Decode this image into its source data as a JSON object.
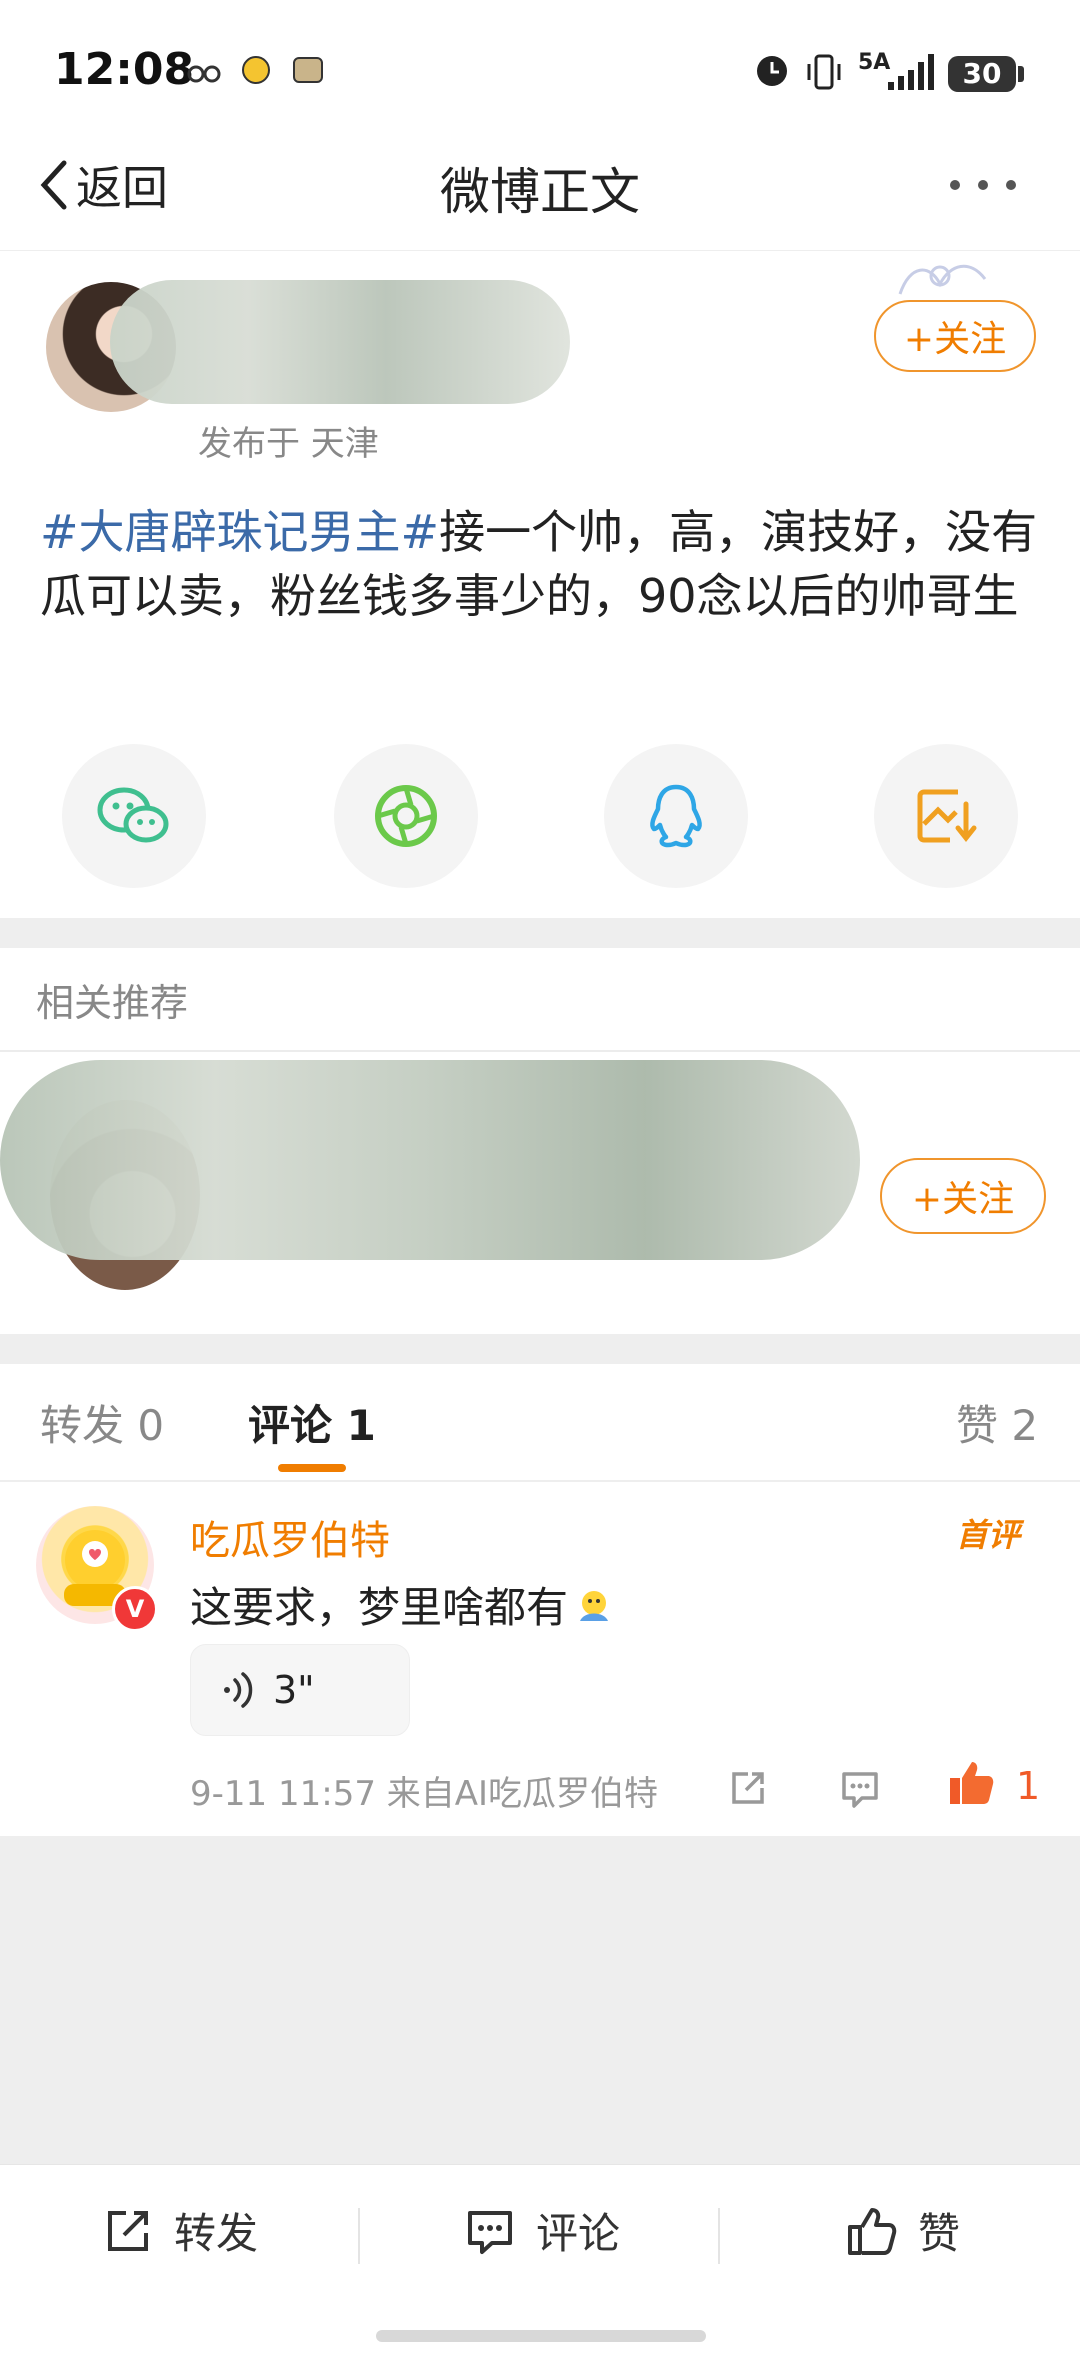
{
  "status_bar": {
    "time": "12:08",
    "network": "5A",
    "battery": "30"
  },
  "nav": {
    "back_label": "返回",
    "title": "微博正文"
  },
  "post": {
    "location": "发布于 天津",
    "follow_label": "+关注",
    "topic": "#大唐辟珠记男主#",
    "text": "接一个帅，高，演技好，没有瓜可以卖，粉丝钱多事少的，90念以后的帅哥生"
  },
  "share_icons": [
    "wechat-icon",
    "moments-icon",
    "qq-icon",
    "save-image-icon"
  ],
  "related": {
    "title": "相关推荐",
    "follow_label": "+关注"
  },
  "tabs": {
    "repost": "转发 0",
    "comment": "评论 1",
    "like": "赞 2"
  },
  "comment": {
    "author": "吃瓜罗伯特",
    "badge": "首评",
    "text": "这要求，梦里啥都有",
    "voice_duration": "3\"",
    "meta": "9-11 11:57 来自AI吃瓜罗伯特",
    "like_count": "1"
  },
  "bottom_bar": {
    "repost_label": "转发",
    "comment_label": "评论",
    "like_label": "赞"
  },
  "colors": {
    "accent": "#f07d00",
    "topic": "#3b6aa8",
    "like": "#f05a28"
  }
}
